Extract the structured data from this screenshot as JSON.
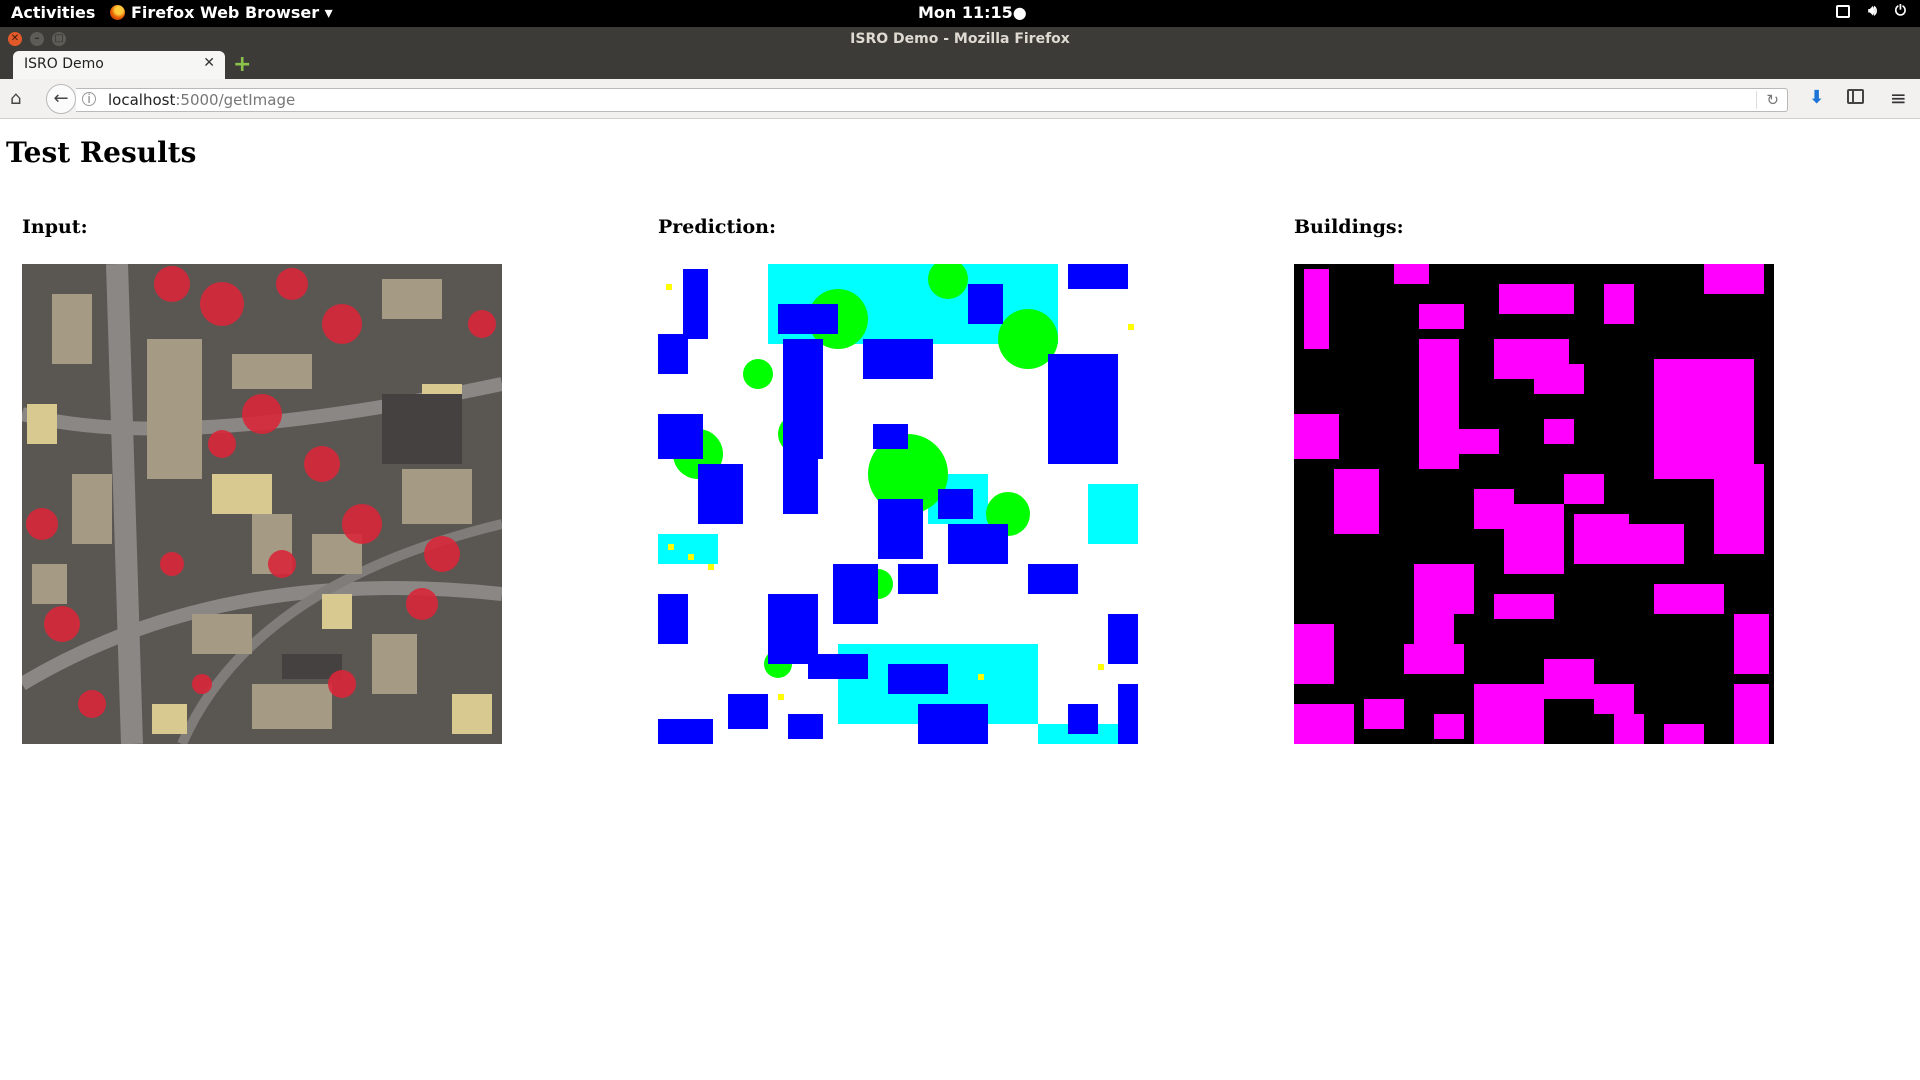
{
  "system_bar": {
    "activities": "Activities",
    "app_menu": "Firefox Web Browser ▾",
    "clock": "Mon 11:15●"
  },
  "window": {
    "title": "ISRO Demo - Mozilla Firefox"
  },
  "tabs": [
    {
      "title": "ISRO Demo"
    }
  ],
  "url": {
    "host": "localhost",
    "path": ":5000/getImage"
  },
  "page": {
    "title": "Test Results",
    "panels": [
      {
        "label": "Input:"
      },
      {
        "label": "Prediction:"
      },
      {
        "label": "Buildings:"
      }
    ]
  },
  "colors": {
    "building": "#0000ff",
    "vegetation": "#00ff00",
    "low_vegetation": "#00ffff",
    "mask": "#ff00ff",
    "road": "#ffffff"
  }
}
